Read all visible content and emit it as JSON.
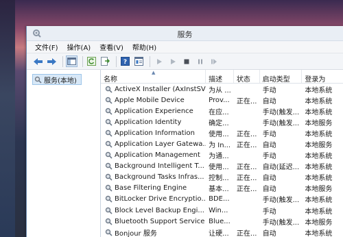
{
  "window": {
    "title": "服务"
  },
  "menu": [
    "文件(F)",
    "操作(A)",
    "查看(V)",
    "帮助(H)"
  ],
  "toolbar": {
    "icons": [
      "back-arrow-icon",
      "forward-arrow-icon",
      "console-tree-icon",
      "refresh-icon",
      "export-icon",
      "help-icon",
      "properties-icon",
      "start-icon",
      "start-alt-icon",
      "stop-icon",
      "pause-icon",
      "restart-icon"
    ]
  },
  "tree": {
    "node_label": "服务(本地)"
  },
  "list": {
    "headers": {
      "name": "名称",
      "description": "描述",
      "status": "状态",
      "startup": "启动类型",
      "logon": "登录为"
    },
    "rows": [
      {
        "name": "ActiveX Installer (AxInstSV)",
        "description": "为从 ...",
        "status": "",
        "startup": "手动",
        "logon": "本地系统"
      },
      {
        "name": "Apple Mobile Device",
        "description": "Prov...",
        "status": "正在...",
        "startup": "自动",
        "logon": "本地系统"
      },
      {
        "name": "Application Experience",
        "description": "在应...",
        "status": "",
        "startup": "手动(触发...",
        "logon": "本地系统"
      },
      {
        "name": "Application Identity",
        "description": "确定...",
        "status": "",
        "startup": "手动(触发...",
        "logon": "本地服务"
      },
      {
        "name": "Application Information",
        "description": "使用...",
        "status": "正在...",
        "startup": "手动",
        "logon": "本地系统"
      },
      {
        "name": "Application Layer Gatewa...",
        "description": "为 In...",
        "status": "正在...",
        "startup": "自动",
        "logon": "本地服务"
      },
      {
        "name": "Application Management",
        "description": "为通...",
        "status": "",
        "startup": "手动",
        "logon": "本地系统"
      },
      {
        "name": "Background Intelligent T...",
        "description": "使用...",
        "status": "正在...",
        "startup": "自动(延迟...",
        "logon": "本地系统"
      },
      {
        "name": "Background Tasks Infras...",
        "description": "控制...",
        "status": "正在...",
        "startup": "自动",
        "logon": "本地系统"
      },
      {
        "name": "Base Filtering Engine",
        "description": "基本...",
        "status": "正在...",
        "startup": "自动",
        "logon": "本地服务"
      },
      {
        "name": "BitLocker Drive Encryptio...",
        "description": "BDE...",
        "status": "",
        "startup": "手动(触发...",
        "logon": "本地系统"
      },
      {
        "name": "Block Level Backup Engi...",
        "description": "Win...",
        "status": "",
        "startup": "手动",
        "logon": "本地系统"
      },
      {
        "name": "Bluetooth Support Service",
        "description": "Blue...",
        "status": "",
        "startup": "手动(触发...",
        "logon": "本地服务"
      },
      {
        "name": "Bonjour 服务",
        "description": "让硬...",
        "status": "正在...",
        "startup": "自动",
        "logon": "本地系统"
      }
    ]
  },
  "colors": {
    "accent": "#3a78c4",
    "selection": "#d8e8f7",
    "window_border": "#6f8fb5"
  }
}
